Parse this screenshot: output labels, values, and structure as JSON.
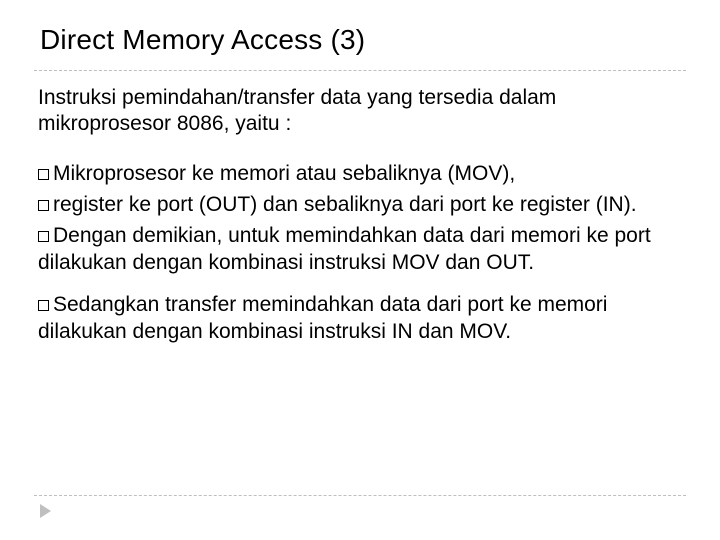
{
  "title": "Direct Memory Access (3)",
  "intro": "Instruksi pemindahan/transfer data yang tersedia dalam mikroprosesor 8086, yaitu :",
  "bullets": [
    {
      "lead": "Mikroprosesor",
      "rest": " ke memori atau sebaliknya (MOV),"
    },
    {
      "lead": "register",
      "rest": " ke port (OUT) dan sebaliknya dari port ke register (IN)."
    },
    {
      "lead": "Dengan",
      "rest": " demikian, untuk memindahkan data dari memori ke port dilakukan dengan kombinasi instruksi MOV dan OUT."
    },
    {
      "lead": "Sedangkan",
      "rest": " transfer memindahkan data dari port ke memori dilakukan dengan kombinasi instruksi IN dan MOV."
    }
  ]
}
